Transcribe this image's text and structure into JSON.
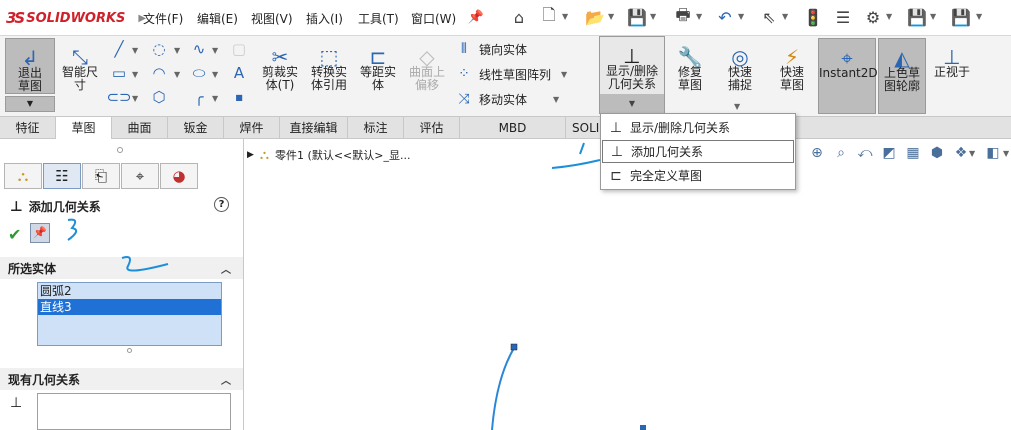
{
  "app": {
    "brand": "SOLIDWORKS"
  },
  "menu": [
    "文件(F)",
    "编辑(E)",
    "视图(V)",
    "插入(I)",
    "工具(T)",
    "窗口(W)"
  ],
  "toolbar": {
    "exit_sketch": "退出草图",
    "smart_dim": "智能尺寸",
    "trim": "剪裁实体(T)",
    "convert": "转换实体引用",
    "offset": "等距实体",
    "surface_offset": "曲面上偏移",
    "mirror": "镜向实体",
    "linear_pattern": "线性草图阵列",
    "move": "移动实体",
    "display_relations": "显示/删除几何关系",
    "repair": "修复草图",
    "quick_snap": "快速捕捉",
    "rapid_sketch": "快速草图",
    "instant2d": "Instant2D",
    "shaded_contours": "上色草图轮廓",
    "normal_to": "正视于"
  },
  "tabs": [
    "特征",
    "草图",
    "曲面",
    "钣金",
    "焊件",
    "直接编辑",
    "标注",
    "评估",
    "MBD Dimensions",
    "SOLI"
  ],
  "dropdown": {
    "items": [
      "显示/删除几何关系",
      "添加几何关系",
      "完全定义草图"
    ]
  },
  "panel": {
    "title": "添加几何关系",
    "help": "?",
    "selected_entities_label": "所选实体",
    "selected_entities": [
      "圆弧2",
      "直线3"
    ],
    "existing_relations_label": "现有几何关系"
  },
  "graphics": {
    "tree_text": "零件1  (默认<<默认>_显..."
  },
  "annotations": [
    "1",
    "2",
    "3"
  ],
  "colors": {
    "accent": "#1f71d6",
    "annotation": "#1d8fd8",
    "brand": "#d0202a"
  }
}
